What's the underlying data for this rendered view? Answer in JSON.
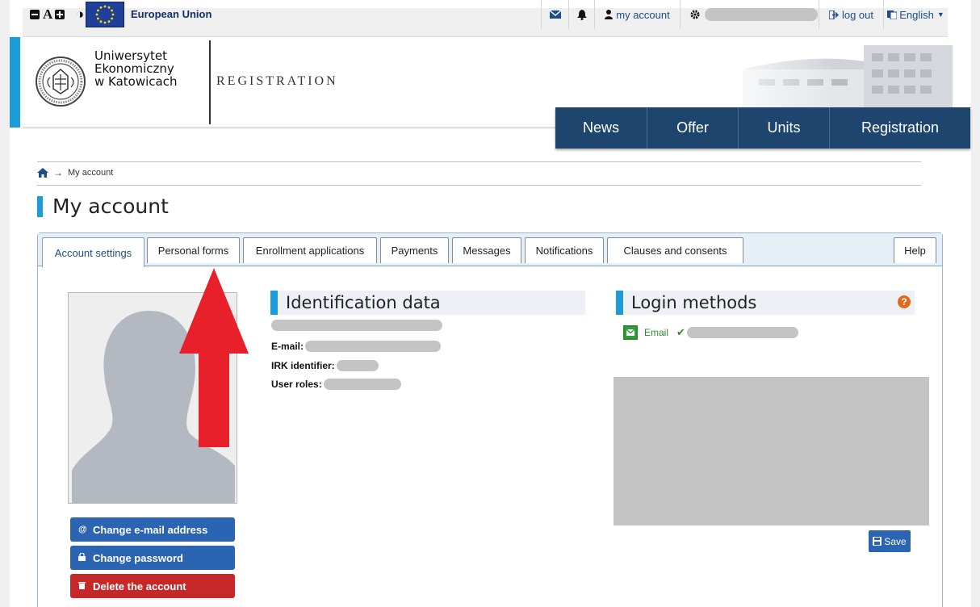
{
  "topbar": {
    "decrease_font": "A",
    "contrast": "◑",
    "eu_label": "European Union",
    "account_label": "my account",
    "logout_label": "log out",
    "language_label": "English"
  },
  "header": {
    "uni_line1": "Uniwersytet",
    "uni_line2": "Ekonomiczny",
    "uni_line3": "w Katowicach",
    "section_title": "REGISTRATION"
  },
  "nav": {
    "items": [
      {
        "label": "News"
      },
      {
        "label": "Offer"
      },
      {
        "label": "Units"
      },
      {
        "label": "Registration"
      }
    ]
  },
  "breadcrumb": {
    "current": "My account"
  },
  "page": {
    "title": "My account"
  },
  "tabs": [
    {
      "label": "Account settings"
    },
    {
      "label": "Personal forms"
    },
    {
      "label": "Enrollment applications"
    },
    {
      "label": "Payments"
    },
    {
      "label": "Messages"
    },
    {
      "label": "Notifications"
    },
    {
      "label": "Clauses and consents"
    },
    {
      "label": "Help"
    }
  ],
  "account_buttons": {
    "change_email": "Change e-mail address",
    "change_password": "Change password",
    "delete_account": "Delete the account"
  },
  "identification": {
    "title": "Identification data",
    "email_label": "E-mail:",
    "irk_label": "IRK identifier:",
    "roles_label": "User roles:"
  },
  "login_methods": {
    "title": "Login methods",
    "email_method": "Email"
  },
  "save_label": "Save",
  "colors": {
    "accent": "#1b9bd7",
    "nav_bg": "#1d456e",
    "primary_button": "#2a64b3",
    "danger_button": "#c6282a",
    "annotation_arrow": "#e8202a"
  }
}
